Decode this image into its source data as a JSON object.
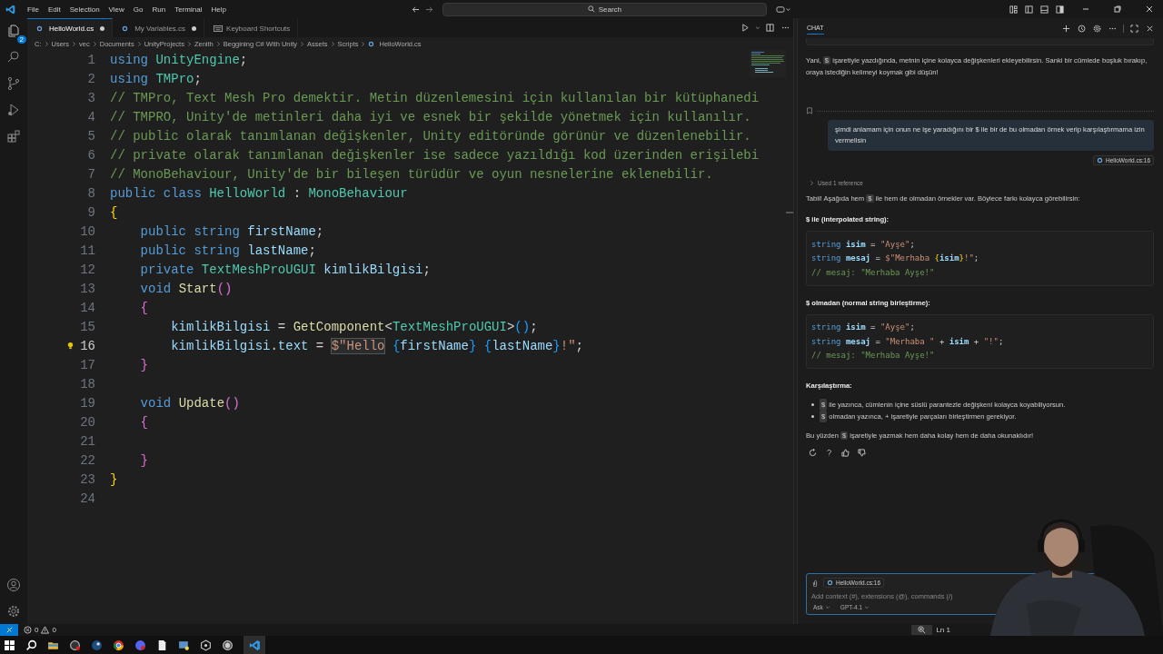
{
  "titlebar": {
    "menu": [
      "File",
      "Edit",
      "Selection",
      "View",
      "Go",
      "Run",
      "Terminal",
      "Help"
    ],
    "search": {
      "placeholder": "Search"
    }
  },
  "activity_bar": {
    "explorer_badge": "2"
  },
  "tabs": [
    {
      "label": "HelloWorld.cs",
      "kind": "csharp",
      "selected": true,
      "modified": true
    },
    {
      "label": "My Variables.cs",
      "kind": "csharp",
      "selected": false,
      "modified": true
    },
    {
      "label": "Keyboard Shortcuts",
      "kind": "keyboard",
      "selected": false,
      "modified": false
    }
  ],
  "breadcrumb": [
    "C:",
    "Users",
    "vec",
    "Documents",
    "UnityProjects",
    "Zenith",
    "Beggining C# With Unity",
    "Assets",
    "Scripts",
    "HelloWorld.cs"
  ],
  "editor": {
    "lines": [
      {
        "number": "1",
        "active": false,
        "tokens": [
          {
            "kind": "kw",
            "text": "using "
          },
          {
            "kind": "type",
            "text": "UnityEngine"
          },
          {
            "kind": "punc",
            "text": ";"
          }
        ]
      },
      {
        "number": "2",
        "active": false,
        "tokens": [
          {
            "kind": "kw",
            "text": "using "
          },
          {
            "kind": "type",
            "text": "TMPro"
          },
          {
            "kind": "punc",
            "text": ";"
          }
        ]
      },
      {
        "number": "3",
        "active": false,
        "tokens": [
          {
            "kind": "com",
            "text": "// TMPro, Text Mesh Pro demektir. Metin düzenlemesini için kullanılan bir kütüphanedi"
          }
        ]
      },
      {
        "number": "4",
        "active": false,
        "tokens": [
          {
            "kind": "com",
            "text": "// TMPRO, Unity'de metinleri daha iyi ve esnek bir şekilde yönetmek için kullanılır."
          }
        ]
      },
      {
        "number": "5",
        "active": false,
        "tokens": [
          {
            "kind": "com",
            "text": "// public olarak tanımlanan değişkenler, Unity editöründe görünür ve düzenlenebilir."
          }
        ]
      },
      {
        "number": "6",
        "active": false,
        "tokens": [
          {
            "kind": "com",
            "text": "// private olarak tanımlanan değişkenler ise sadece yazıldığı kod üzerinden erişilebi"
          }
        ]
      },
      {
        "number": "7",
        "active": false,
        "tokens": [
          {
            "kind": "com",
            "text": "// MonoBehaviour, Unity'de bir bileşen türüdür ve oyun nesnelerine eklenebilir."
          }
        ]
      },
      {
        "number": "8",
        "active": false,
        "tokens": [
          {
            "kind": "kw",
            "text": "public class "
          },
          {
            "kind": "type",
            "text": "HelloWorld"
          },
          {
            "kind": "punc",
            "text": " : "
          },
          {
            "kind": "type",
            "text": "MonoBehaviour"
          }
        ]
      },
      {
        "number": "9",
        "active": false,
        "tokens": [
          {
            "kind": "b1",
            "text": "{"
          }
        ]
      },
      {
        "number": "10",
        "active": false,
        "tokens": [
          {
            "kind": "kw",
            "text": "    public string "
          },
          {
            "kind": "id",
            "text": "firstName"
          },
          {
            "kind": "punc",
            "text": ";"
          }
        ]
      },
      {
        "number": "11",
        "active": false,
        "tokens": [
          {
            "kind": "kw",
            "text": "    public string "
          },
          {
            "kind": "id",
            "text": "lastName"
          },
          {
            "kind": "punc",
            "text": ";"
          }
        ]
      },
      {
        "number": "12",
        "active": false,
        "tokens": [
          {
            "kind": "kw",
            "text": "    private "
          },
          {
            "kind": "type",
            "text": "TextMeshProUGUI "
          },
          {
            "kind": "id",
            "text": "kimlikBilgisi"
          },
          {
            "kind": "punc",
            "text": ";"
          }
        ]
      },
      {
        "number": "13",
        "active": false,
        "tokens": [
          {
            "kind": "kw",
            "text": "    void "
          },
          {
            "kind": "fn",
            "text": "Start"
          },
          {
            "kind": "b2",
            "text": "()"
          }
        ]
      },
      {
        "number": "14",
        "active": false,
        "tokens": [
          {
            "kind": "b2",
            "text": "    {"
          }
        ]
      },
      {
        "number": "15",
        "active": false,
        "tokens": [
          {
            "kind": "id",
            "text": "        kimlikBilgisi"
          },
          {
            "kind": "punc",
            "text": " = "
          },
          {
            "kind": "fn",
            "text": "GetComponent"
          },
          {
            "kind": "punc",
            "text": "<"
          },
          {
            "kind": "type",
            "text": "TextMeshProUGUI"
          },
          {
            "kind": "punc",
            "text": ">"
          },
          {
            "kind": "b3",
            "text": "()"
          },
          {
            "kind": "punc",
            "text": ";"
          }
        ]
      },
      {
        "number": "16",
        "active": true,
        "tokens": [
          {
            "kind": "id",
            "text": "        kimlikBilgisi"
          },
          {
            "kind": "punc",
            "text": "."
          },
          {
            "kind": "id",
            "text": "text"
          },
          {
            "kind": "punc",
            "text": " = "
          },
          {
            "kind": "strbox",
            "text": "$\"Hello"
          },
          {
            "kind": "b3",
            "text": " {"
          },
          {
            "kind": "id",
            "text": "firstName"
          },
          {
            "kind": "b3",
            "text": "}"
          },
          {
            "kind": "b3",
            "text": " {"
          },
          {
            "kind": "id",
            "text": "lastName"
          },
          {
            "kind": "b3",
            "text": "}"
          },
          {
            "kind": "str",
            "text": "!\""
          },
          {
            "kind": "punc",
            "text": ";"
          }
        ]
      },
      {
        "number": "17",
        "active": false,
        "tokens": [
          {
            "kind": "b2",
            "text": "    }"
          }
        ]
      },
      {
        "number": "18",
        "active": false
      },
      {
        "number": "19",
        "active": false,
        "tokens": [
          {
            "kind": "kw",
            "text": "    void "
          },
          {
            "kind": "fn",
            "text": "Update"
          },
          {
            "kind": "b2",
            "text": "()"
          }
        ]
      },
      {
        "number": "20",
        "active": false,
        "tokens": [
          {
            "kind": "b2",
            "text": "    {"
          }
        ]
      },
      {
        "number": "21",
        "active": false
      },
      {
        "number": "22",
        "active": false,
        "tokens": [
          {
            "kind": "b2",
            "text": "    }"
          }
        ]
      },
      {
        "number": "23",
        "active": false,
        "tokens": [
          {
            "kind": "b1",
            "text": "}"
          }
        ]
      },
      {
        "number": "24",
        "active": false
      }
    ]
  },
  "chat": {
    "title": "CHAT",
    "items": [
      {
        "kind": "paragraph",
        "segments": [
          {
            "kind": "text",
            "text": "Yani, "
          },
          {
            "kind": "code",
            "text": "$"
          },
          {
            "kind": "text",
            "text": " işaretiyle yazdığında, metnin içine kolayca değişkenleri ekleyebilirsin. Sanki bir cümlede boşluk bırakıp, oraya istediğin kelimeyi koymak gibi düşün!"
          }
        ]
      },
      {
        "kind": "divider"
      },
      {
        "kind": "user-message",
        "text": "şimdi anlamam için onun ne işe yaradığını bir $ ile bir de bu olmadan örnek verip karşılaştırmama izin vermelisin"
      },
      {
        "kind": "reference",
        "text": "HelloWorld.cs:16"
      },
      {
        "kind": "used-references",
        "text": "Used 1 reference",
        "expanded": false
      },
      {
        "kind": "paragraph",
        "segments": [
          {
            "kind": "text",
            "text": "Tabii! Aşağıda hem "
          },
          {
            "kind": "code",
            "text": "$"
          },
          {
            "kind": "text",
            "text": " ile hem de olmadan örnekler var. Böylece farkı kolayca görebilirsin:"
          }
        ]
      },
      {
        "kind": "heading",
        "text": "$ ile (interpolated string):"
      },
      {
        "kind": "code",
        "lines": [
          [
            {
              "kind": "kw",
              "text": "string "
            },
            {
              "kind": "id",
              "text": "isim"
            },
            {
              "kind": "punc",
              "text": " = "
            },
            {
              "kind": "str",
              "text": "\"Ayşe\""
            },
            {
              "kind": "punc",
              "text": ";"
            }
          ],
          [
            {
              "kind": "kw",
              "text": "string "
            },
            {
              "kind": "id",
              "text": "mesaj"
            },
            {
              "kind": "punc",
              "text": " = "
            },
            {
              "kind": "str",
              "text": "$\"Merhaba "
            },
            {
              "kind": "b1",
              "text": "{"
            },
            {
              "kind": "id",
              "text": "isim"
            },
            {
              "kind": "b1",
              "text": "}"
            },
            {
              "kind": "str",
              "text": "!\""
            },
            {
              "kind": "punc",
              "text": ";"
            }
          ],
          [
            {
              "kind": "com",
              "text": "// mesaj: \"Merhaba Ayşe!\""
            }
          ]
        ]
      },
      {
        "kind": "heading",
        "text": "$ olmadan (normal string birleştirme):"
      },
      {
        "kind": "code",
        "lines": [
          [
            {
              "kind": "kw",
              "text": "string "
            },
            {
              "kind": "id",
              "text": "isim"
            },
            {
              "kind": "punc",
              "text": " = "
            },
            {
              "kind": "str",
              "text": "\"Ayşe\""
            },
            {
              "kind": "punc",
              "text": ";"
            }
          ],
          [
            {
              "kind": "kw",
              "text": "string "
            },
            {
              "kind": "id",
              "text": "mesaj"
            },
            {
              "kind": "punc",
              "text": " = "
            },
            {
              "kind": "str",
              "text": "\"Merhaba \""
            },
            {
              "kind": "punc",
              "text": " + "
            },
            {
              "kind": "id",
              "text": "isim"
            },
            {
              "kind": "punc",
              "text": " + "
            },
            {
              "kind": "str",
              "text": "\"!\""
            },
            {
              "kind": "punc",
              "text": ";"
            }
          ],
          [
            {
              "kind": "com",
              "text": "// mesaj: \"Merhaba Ayşe!\""
            }
          ]
        ]
      },
      {
        "kind": "heading",
        "text": "Karşılaştırma:"
      },
      {
        "kind": "bullets",
        "items": [
          [
            {
              "kind": "code",
              "text": "$"
            },
            {
              "kind": "text",
              "text": " ile yazınca, cümlenin içine süslü parantezle değişkeni kolayca koyabiliyorsun."
            }
          ],
          [
            {
              "kind": "code",
              "text": "$"
            },
            {
              "kind": "text",
              "text": " olmadan yazınca, + işaretiyle parçaları birleştirmen gerekiyor."
            }
          ]
        ]
      },
      {
        "kind": "paragraph",
        "segments": [
          {
            "kind": "text",
            "text": "Bu yüzden "
          },
          {
            "kind": "code",
            "text": "$"
          },
          {
            "kind": "text",
            "text": " işaretiyle yazmak hem daha kolay hem de daha okunaklıdır!"
          }
        ]
      },
      {
        "kind": "feedback"
      }
    ],
    "input": {
      "context_file": "HelloWorld.cs:16",
      "placeholder": "Add context (#), extensions (@), commands (/)",
      "mode": "Ask",
      "model": "GPT-4.1"
    }
  },
  "status_bar": {
    "errors": "0",
    "warnings": "0",
    "position": "Ln 1"
  }
}
